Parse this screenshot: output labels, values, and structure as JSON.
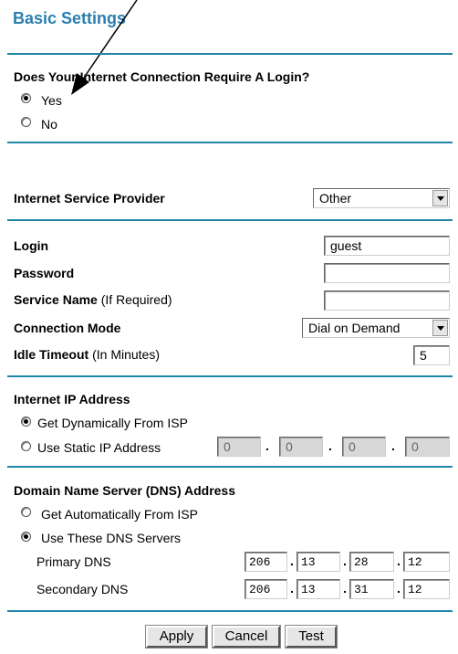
{
  "page": {
    "title": "Basic Settings"
  },
  "login_section": {
    "question": "Does Your Internet Connection Require A Login?",
    "yes_label": "Yes",
    "no_label": "No",
    "selected": "Yes"
  },
  "isp": {
    "label": "Internet Service Provider",
    "selected": "Other"
  },
  "credentials": {
    "login_label": "Login",
    "login_value": "guest",
    "password_label": "Password",
    "password_value": "",
    "service_label_bold": "Service Name",
    "service_label_note": "(If Required)",
    "service_value": "",
    "mode_label": "Connection Mode",
    "mode_selected": "Dial on Demand",
    "idle_label_bold": "Idle Timeout",
    "idle_label_note": "(In Minutes)",
    "idle_value": "5"
  },
  "ip_section": {
    "heading": "Internet IP Address",
    "dynamic_label": "Get Dynamically From ISP",
    "static_label": "Use Static IP Address",
    "selected": "dynamic",
    "static_ip": [
      "0",
      "0",
      "0",
      "0"
    ]
  },
  "dns_section": {
    "heading": "Domain Name Server (DNS) Address",
    "auto_label": "Get Automatically From ISP",
    "manual_label": "Use These DNS Servers",
    "selected": "manual",
    "primary_label": "Primary DNS",
    "primary": [
      "206",
      "13",
      "28",
      "12"
    ],
    "secondary_label": "Secondary DNS",
    "secondary": [
      "206",
      "13",
      "31",
      "12"
    ]
  },
  "buttons": {
    "apply": "Apply",
    "cancel": "Cancel",
    "test": "Test"
  }
}
